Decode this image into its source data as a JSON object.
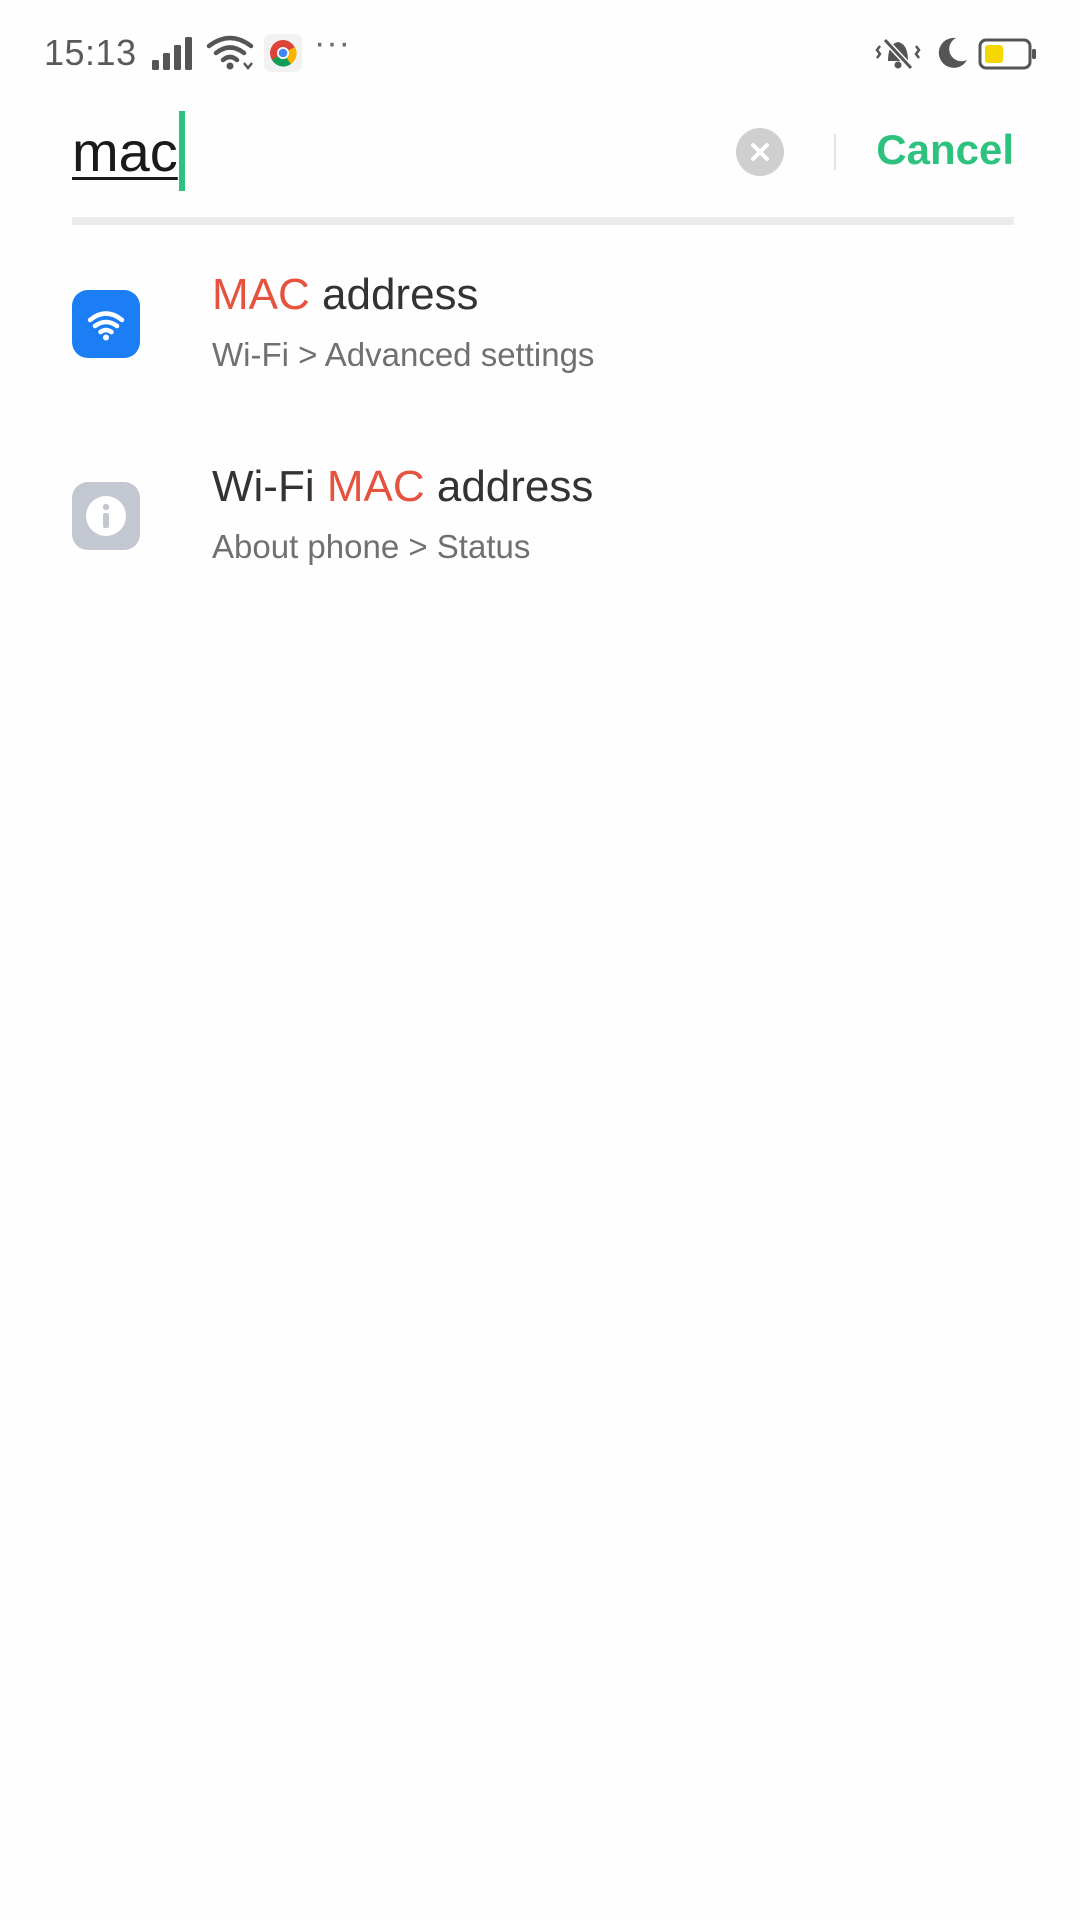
{
  "status_bar": {
    "time": "15:13",
    "more": "···",
    "icons": [
      "signal-icon",
      "wifi-icon",
      "chrome-icon",
      "vibrate-icon",
      "moon-icon",
      "battery-icon"
    ],
    "battery_color": "#f5d800"
  },
  "search": {
    "query": "mac",
    "cancel_label": "Cancel",
    "accent_color": "#2ec27e"
  },
  "results": [
    {
      "icon": "wifi-icon",
      "icon_color": "#1b7ef5",
      "title_before": "",
      "title_highlight": "MAC",
      "title_after": " address",
      "path": "Wi-Fi > Advanced settings"
    },
    {
      "icon": "info-icon",
      "icon_color": "#c2c7d1",
      "title_before": "Wi-Fi ",
      "title_highlight": "MAC",
      "title_after": " address",
      "path": "About phone > Status"
    }
  ],
  "highlight_color": "#e5533f"
}
